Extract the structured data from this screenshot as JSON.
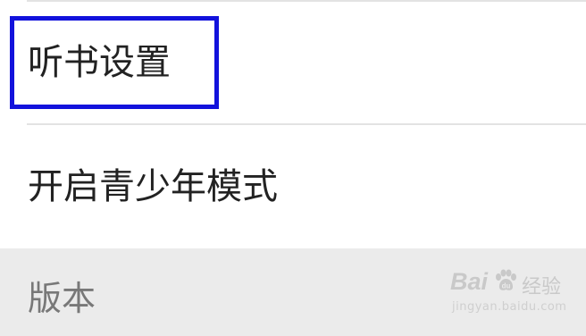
{
  "settings": {
    "items": [
      {
        "label": "听书设置",
        "highlighted": true
      },
      {
        "label": "开启青少年模式",
        "highlighted": false
      }
    ],
    "section": {
      "label": "版本"
    }
  },
  "watermark": {
    "brand": "Bai",
    "brand_suffix": "经验",
    "url": "jingyan.baidu.com",
    "icon": "paw-icon"
  },
  "colors": {
    "highlight_border": "#1212dc",
    "divider": "#e3e3e3",
    "section_background": "#ebebeb",
    "text_primary": "#222222",
    "text_secondary": "#787878"
  }
}
